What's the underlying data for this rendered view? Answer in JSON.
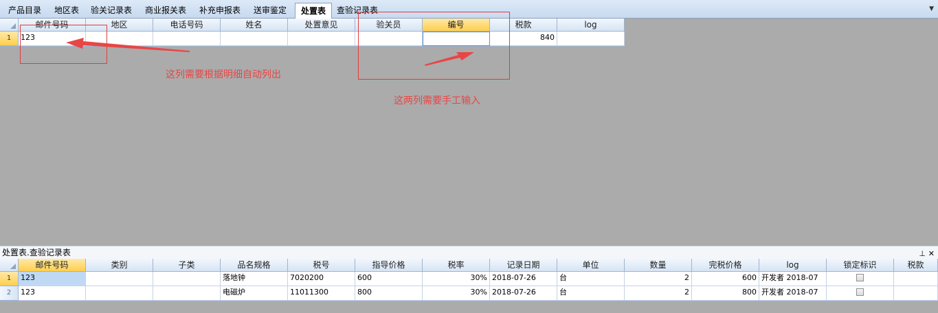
{
  "tabs": [
    {
      "label": "产品目录",
      "active": false
    },
    {
      "label": "地区表",
      "active": false
    },
    {
      "label": "验关记录表",
      "active": false
    },
    {
      "label": "商业报关表",
      "active": false
    },
    {
      "label": "补充申报表",
      "active": false
    },
    {
      "label": "送审鉴定",
      "active": false
    },
    {
      "label": "处置表",
      "active": true
    },
    {
      "label": "查验记录表",
      "active": false
    }
  ],
  "top_grid": {
    "columns": [
      "邮件号码",
      "地区",
      "电话号码",
      "姓名",
      "处置意见",
      "验关员",
      "编号",
      "税款",
      "log"
    ],
    "selected_column": 6,
    "rows": [
      {
        "row_num": "1",
        "cells": [
          "123",
          "",
          "",
          "",
          "",
          "",
          "",
          "840",
          ""
        ]
      }
    ]
  },
  "annotations": {
    "note_left": "这列需要根据明细自动列出",
    "note_right": "这两列需要手工输入"
  },
  "bottom_panel": {
    "title": "处置表.查验记录表",
    "pin_icon": "pin-icon",
    "close_icon": "close-icon",
    "columns": [
      "邮件号码",
      "类别",
      "子类",
      "品名规格",
      "税号",
      "指导价格",
      "税率",
      "记录日期",
      "单位",
      "数量",
      "完税价格",
      "log",
      "锁定标识",
      "税款"
    ],
    "selected_column": 0,
    "rows": [
      {
        "row_num": "1",
        "cells": [
          "123",
          "",
          "",
          "落地钟",
          "7020200",
          "600",
          "30%",
          "2018-07-26",
          "台",
          "2",
          "600",
          "开发者 2018-07",
          "",
          ""
        ]
      },
      {
        "row_num": "2",
        "cells": [
          "123",
          "",
          "",
          "电磁炉",
          "11011300",
          "800",
          "30%",
          "2018-07-26",
          "台",
          "2",
          "800",
          "开发者 2018-07",
          "",
          ""
        ]
      }
    ]
  },
  "colors": {
    "accent_selected": "#ffcf4d",
    "annotation": "#e23b3b"
  }
}
